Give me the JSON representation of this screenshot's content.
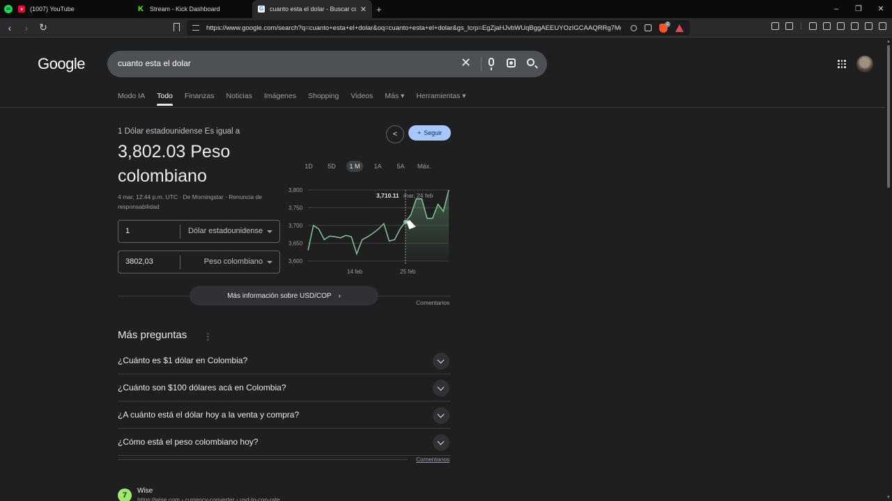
{
  "browser": {
    "tabs": [
      {
        "label": "(1007) YouTube"
      },
      {
        "label": "Stream - Kick Dashboard"
      },
      {
        "label": "cuanto esta el dolar - Buscar con Google"
      }
    ],
    "new_tab": "+",
    "url": "https://www.google.com/search?q=cuanto+esta+el+dolar&oq=cuanto+esta+el+dolar&gs_lcrp=EgZjaHJvbWUqBggAEEUYOzIGCAAQRRg7Mg...",
    "brave_count": "2"
  },
  "google": {
    "logo": "Google",
    "query": "cuanto esta el dolar",
    "nav": [
      "Modo IA",
      "Todo",
      "Finanzas",
      "Noticias",
      "Imágenes",
      "Shopping",
      "Videos",
      "Más ▾",
      "Herramientas ▾"
    ]
  },
  "converter": {
    "equals_label": "1 Dólar estadounidense Es igual a",
    "big_value_line1": "3,802.03 Peso",
    "big_value_line2": "colombiano",
    "meta_line1": "4 mar, 12:44 p.m. UTC · De Morningstar · Renuncia de",
    "meta_line2": "responsabilidad",
    "follow": "Seguir",
    "from_amount": "1",
    "from_currency": "Dólar estadounidense",
    "to_amount": "3802,03",
    "to_currency": "Peso colombiano",
    "ranges": [
      "1D",
      "5D",
      "1 M",
      "1A",
      "5A",
      "Máx."
    ],
    "active_range": "1 M",
    "more_info": "Más información sobre USD/COP",
    "comments": "Comentarios"
  },
  "chart_data": {
    "type": "area",
    "ylim": [
      3600,
      3800
    ],
    "yticks": [
      "3,800",
      "3,750",
      "3,700",
      "3,650",
      "3,600"
    ],
    "xticks": [
      "14 feb",
      "25 feb"
    ],
    "tooltip_value": "3,710.11",
    "tooltip_date": "mar, 24 feb",
    "values": [
      3630,
      3700,
      3690,
      3660,
      3670,
      3668,
      3665,
      3672,
      3668,
      3620,
      3660,
      3668,
      3678,
      3690,
      3705,
      3656,
      3660,
      3690,
      3710,
      3730,
      3775,
      3775,
      3720,
      3720,
      3760,
      3740,
      3800
    ]
  },
  "questions": {
    "title": "Más preguntas",
    "items": [
      "¿Cuánto es $1 dólar en Colombia?",
      "¿Cuánto son $100 dólares acá en Colombia?",
      "¿A cuánto está el dólar hoy a la venta y compra?",
      "¿Cómo está el peso colombiano hoy?"
    ],
    "comments": "Comentarios"
  },
  "result": {
    "site": "Wise",
    "url": "https://wise.com › currency-converter › usd-to-cop-rate"
  },
  "colors": {
    "chart_line": "#81c995",
    "follow_bg": "#a8c7fa",
    "page_bg": "#1f1f1f"
  }
}
